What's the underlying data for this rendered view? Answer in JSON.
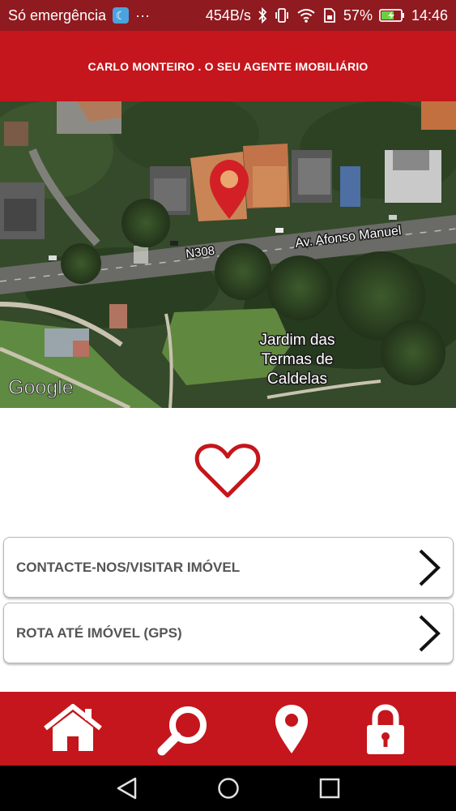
{
  "status_bar": {
    "carrier": "Só emergência",
    "more": "···",
    "speed": "454B/s",
    "battery": "57%",
    "time": "14:46",
    "icons": [
      "moon-icon",
      "bluetooth-icon",
      "vibrate-icon",
      "wifi-icon",
      "sim-icon",
      "battery-icon"
    ]
  },
  "header": {
    "title": "CARLO MONTEIRO . O SEU AGENTE IMOBILIÁRIO"
  },
  "map": {
    "street_label": "Av. Afonso Manuel",
    "road_label": "N308",
    "park_label_line1": "Jardim das",
    "park_label_line2": "Termas de",
    "park_label_line3": "Caldelas",
    "attribution": "Google",
    "pin_color": "#d32026"
  },
  "favorite": {
    "icon": "heart-outline-icon",
    "color": "#c4161c"
  },
  "actions": [
    {
      "label": "CONTACTE-NOS/VISITAR IMÓVEL",
      "icon": "chevron-right-icon"
    },
    {
      "label": "ROTA ATÉ IMÓVEL (GPS)",
      "icon": "chevron-right-icon"
    }
  ],
  "bottom_nav": {
    "items": [
      "home-icon",
      "search-icon",
      "location-pin-icon",
      "lock-icon"
    ],
    "background": "#c4161c"
  },
  "system_nav": {
    "items": [
      "back-icon",
      "home-circle-icon",
      "recents-icon"
    ]
  },
  "colors": {
    "status_bar": "#8f1a1f",
    "brand_red": "#c4161c",
    "label_gray": "#555555"
  }
}
